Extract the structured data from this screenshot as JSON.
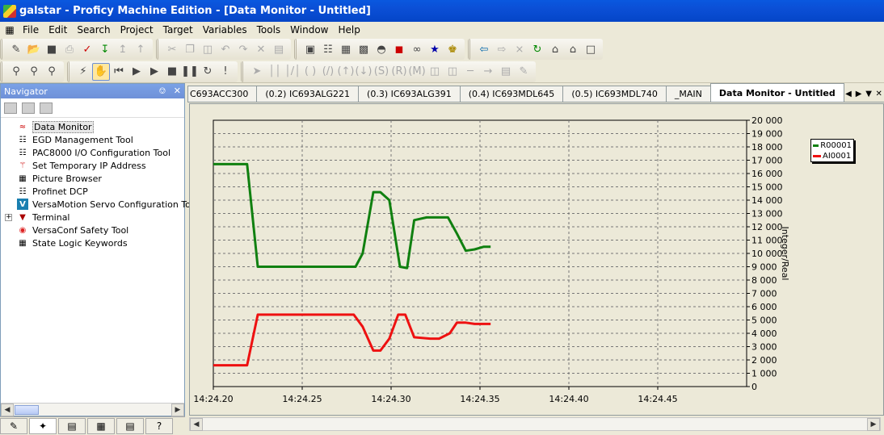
{
  "window": {
    "title": "galstar - Proficy Machine Edition - [Data Monitor - Untitled]"
  },
  "menu": [
    "File",
    "Edit",
    "Search",
    "Project",
    "Target",
    "Variables",
    "Tools",
    "Window",
    "Help"
  ],
  "navigator": {
    "title": "Navigator",
    "pin": "ф",
    "close": "✕",
    "items": [
      {
        "label": "Data Monitor",
        "icon": "chart-icon"
      },
      {
        "label": "EGD Management Tool",
        "icon": "network-icon"
      },
      {
        "label": "PAC8000 I/O Configuration Tool",
        "icon": "io-config-icon"
      },
      {
        "label": "Set Temporary IP Address",
        "icon": "ip-address-icon"
      },
      {
        "label": "Picture Browser",
        "icon": "picture-icon"
      },
      {
        "label": "Profinet DCP",
        "icon": "profinet-icon"
      },
      {
        "label": "VersaMotion Servo Configuration Tool",
        "icon": "servo-icon"
      },
      {
        "label": "Terminal",
        "icon": "terminal-icon"
      },
      {
        "label": "VersaConf Safety Tool",
        "icon": "safety-icon"
      },
      {
        "label": "State Logic Keywords",
        "icon": "keywords-icon"
      }
    ]
  },
  "tabs": [
    "C693ACC300",
    "(0.2) IC693ALG221",
    "(0.3) IC693ALG391",
    "(0.4) IC693MDL645",
    "(0.5) IC693MDL740",
    "_MAIN",
    "Data Monitor - Untitled"
  ],
  "colors": {
    "series1": "#108010",
    "series2": "#ee1111",
    "title_bar": "#0a4fd6"
  },
  "chart_data": {
    "type": "line",
    "ylabel": "Integer/Real",
    "ylim": [
      0,
      20000
    ],
    "yticks": [
      "0",
      "1 000",
      "2 000",
      "3 000",
      "4 000",
      "5 000",
      "6 000",
      "7 000",
      "8 000",
      "9 000",
      "10 000",
      "11 000",
      "12 000",
      "13 000",
      "14 000",
      "15 000",
      "16 000",
      "17 000",
      "18 000",
      "19 000",
      "20 000"
    ],
    "xlim": [
      "14:24.20",
      "14:24.50"
    ],
    "xticks": [
      "14:24.20",
      "14:24.25",
      "14:24.30",
      "14:24.35",
      "14:24.40",
      "14:24.45"
    ],
    "grid": true,
    "legend": "top-right",
    "series": [
      {
        "name": "R00001",
        "color": "#108010",
        "x": [
          "14:24.200",
          "14:24.219",
          "14:24.225",
          "14:24.280",
          "14:24.284",
          "14:24.290",
          "14:24.294",
          "14:24.299",
          "14:24.305",
          "14:24.309",
          "14:24.313",
          "14:24.320",
          "14:24.327",
          "14:24.332",
          "14:24.337",
          "14:24.342",
          "14:24.347",
          "14:24.352",
          "14:24.356"
        ],
        "values": [
          16700,
          16700,
          9000,
          9000,
          10000,
          14600,
          14600,
          14000,
          9000,
          8900,
          12500,
          12700,
          12700,
          12700,
          11500,
          10200,
          10300,
          10500,
          10500
        ]
      },
      {
        "name": "AI0001",
        "color": "#ee1111",
        "x": [
          "14:24.200",
          "14:24.219",
          "14:24.225",
          "14:24.275",
          "14:24.279",
          "14:24.284",
          "14:24.290",
          "14:24.294",
          "14:24.299",
          "14:24.304",
          "14:24.308",
          "14:24.313",
          "14:24.322",
          "14:24.327",
          "14:24.333",
          "14:24.337",
          "14:24.342",
          "14:24.347",
          "14:24.352",
          "14:24.356"
        ],
        "values": [
          1600,
          1600,
          5400,
          5400,
          5400,
          4500,
          2700,
          2700,
          3600,
          5400,
          5400,
          3700,
          3600,
          3600,
          4000,
          4800,
          4800,
          4700,
          4700,
          4700
        ]
      }
    ]
  }
}
